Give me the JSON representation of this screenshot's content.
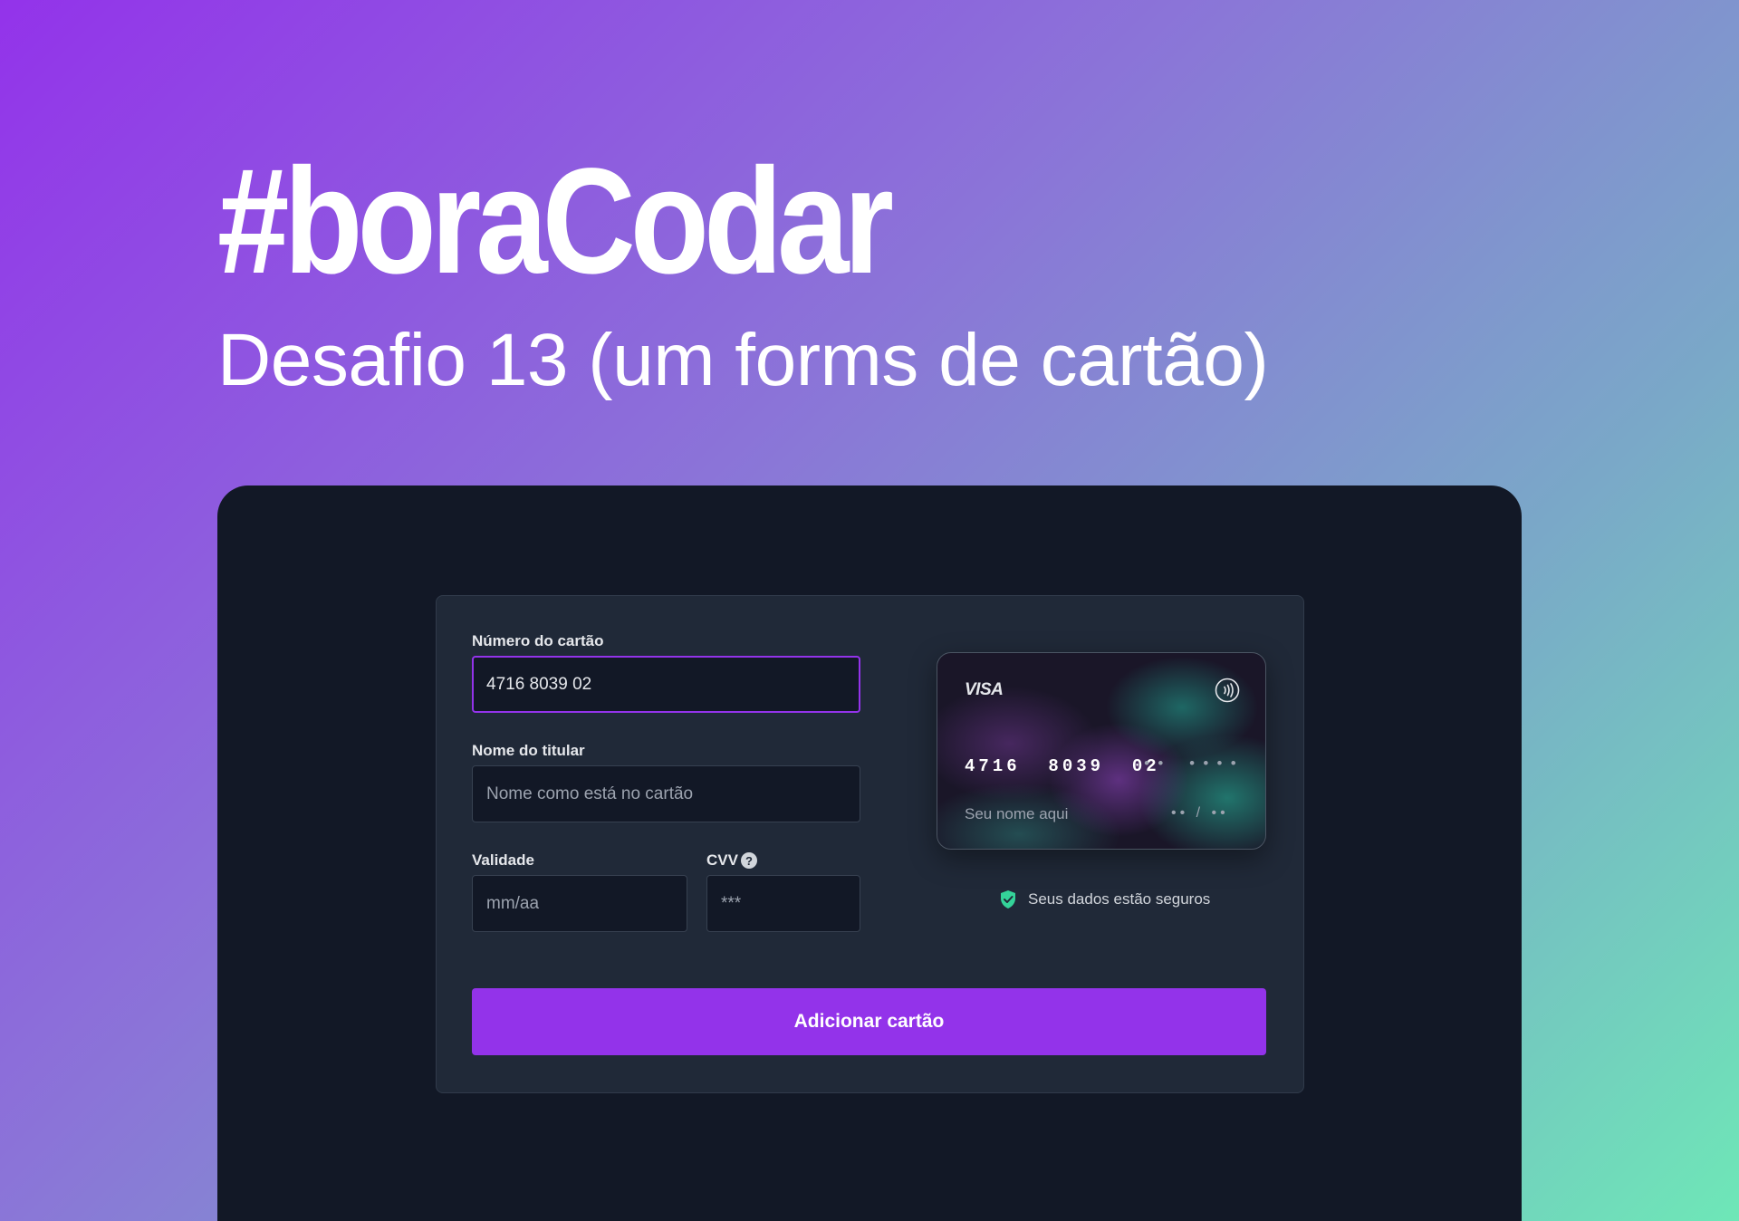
{
  "hero": {
    "title": "#boraCodar",
    "subtitle": "Desafio 13 (um forms de cartão)"
  },
  "form": {
    "card_number": {
      "label": "Número do cartão",
      "value": "4716 8039 02"
    },
    "holder": {
      "label": "Nome do titular",
      "placeholder": "Nome como está no cartão"
    },
    "expiry": {
      "label": "Validade",
      "placeholder": "mm/aa"
    },
    "cvv": {
      "label": "CVV",
      "placeholder": "***",
      "help_glyph": "?"
    },
    "submit_label": "Adicionar cartão"
  },
  "card_preview": {
    "brand": "VISA",
    "number_typed": "4716  8039  02",
    "number_dots_1": "••",
    "number_dots_2": "••••",
    "holder": "Seu nome aqui",
    "expiry": "•• / ••"
  },
  "secure_note": "Seus dados estão seguros",
  "colors": {
    "accent": "#9333ea",
    "background_dark": "#121826",
    "panel": "#202938",
    "secure_green": "#34d399"
  },
  "icons": {
    "help": "help-circle-icon",
    "contactless": "contactless-icon",
    "shield": "shield-check-icon"
  }
}
